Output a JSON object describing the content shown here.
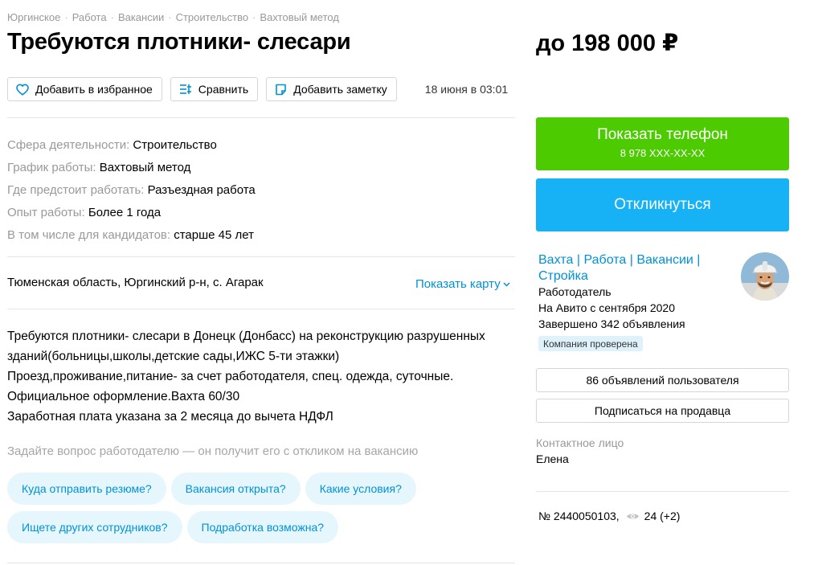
{
  "breadcrumbs": [
    "Юргинское",
    "Работа",
    "Вакансии",
    "Строительство",
    "Вахтовый метод"
  ],
  "breadcrumb_separator": "·",
  "title": "Требуются плотники- слесари",
  "price": "до 198 000 ₽",
  "actions": {
    "favorite_label": "Добавить в избранное",
    "compare_label": "Сравнить",
    "note_label": "Добавить заметку",
    "date": "18 июня в 03:01"
  },
  "params": [
    {
      "key": "Сфера деятельности:",
      "value": "Строительство"
    },
    {
      "key": "График работы:",
      "value": "Вахтовый метод"
    },
    {
      "key": "Где предстоит работать:",
      "value": "Разъездная работа"
    },
    {
      "key": "Опыт работы:",
      "value": "Более 1 года"
    },
    {
      "key": "В том числе для кандидатов:",
      "value": "старше 45 лет"
    }
  ],
  "address": "Тюменская область, Юргинский р-н, с. Агарак",
  "show_map_label": "Показать карту",
  "description": [
    "Требуются плотники- слесари в Донецк (Донбасс) на реконструкцию разрушенных",
    "зданий(больницы,школы,детские сады,ИЖС 5-ти этажки)",
    "Проезд,проживание,питание- за счет работодателя, спец. одежда, суточные.",
    "Официальное оформление.Вахта 60/30",
    "Заработная плата указана за 2 месяца до вычета НДФЛ"
  ],
  "ask_prompt": "Задайте вопрос работодателю — он получит его с откликом на вакансию",
  "quick_questions": [
    [
      "Куда отправить резюме?",
      "Вакансия открыта?",
      "Какие условия?"
    ],
    [
      "Ищете других сотрудников?",
      "Подработка возможна?"
    ]
  ],
  "sidebar": {
    "phone_button_label": "Показать телефон",
    "phone_masked": "8 978 XXX-XX-XX",
    "reply_button_label": "Откликнуться",
    "seller_name": "Вахта | Работа | Вакансии | Стройка",
    "seller_role": "Работодатель",
    "seller_since": "На Авито с сентября 2020",
    "seller_done": "Завершено 342 объявления",
    "verified_badge": "Компания проверена",
    "user_ads_button": "86 объявлений пользователя",
    "subscribe_button": "Подписаться на продавца",
    "contact_label": "Контактное лицо",
    "contact_name": "Елена",
    "ad_number": "№ 2440050103,",
    "views": "24 (+2)"
  },
  "colors": {
    "phone_button": "#4ccb00",
    "reply_button": "#17b2f5",
    "link": "#0091d9",
    "chip_bg": "#e6f6fd"
  }
}
